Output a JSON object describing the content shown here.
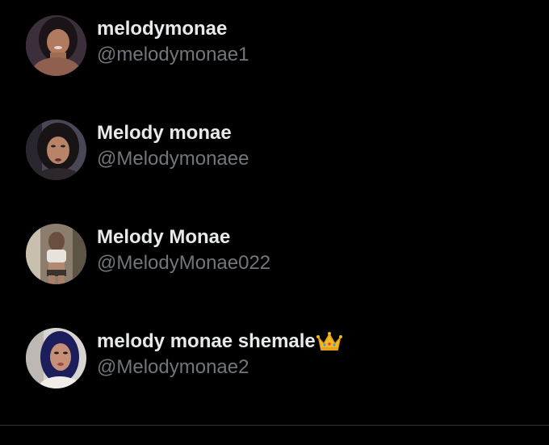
{
  "accounts": [
    {
      "display_name": "melodymonae",
      "handle": "@melodymonae1"
    },
    {
      "display_name": "Melody monae",
      "handle": "@Melodymonaee"
    },
    {
      "display_name": "Melody Monae",
      "handle": "@MelodyMonae022"
    },
    {
      "display_name": "melody monae shemale",
      "handle": "@Melodymonae2",
      "badge_icon": "crown-icon"
    }
  ],
  "colors": {
    "background": "#000000",
    "name": "#e7e9ea",
    "handle": "#71767b",
    "divider": "#2f3336"
  }
}
